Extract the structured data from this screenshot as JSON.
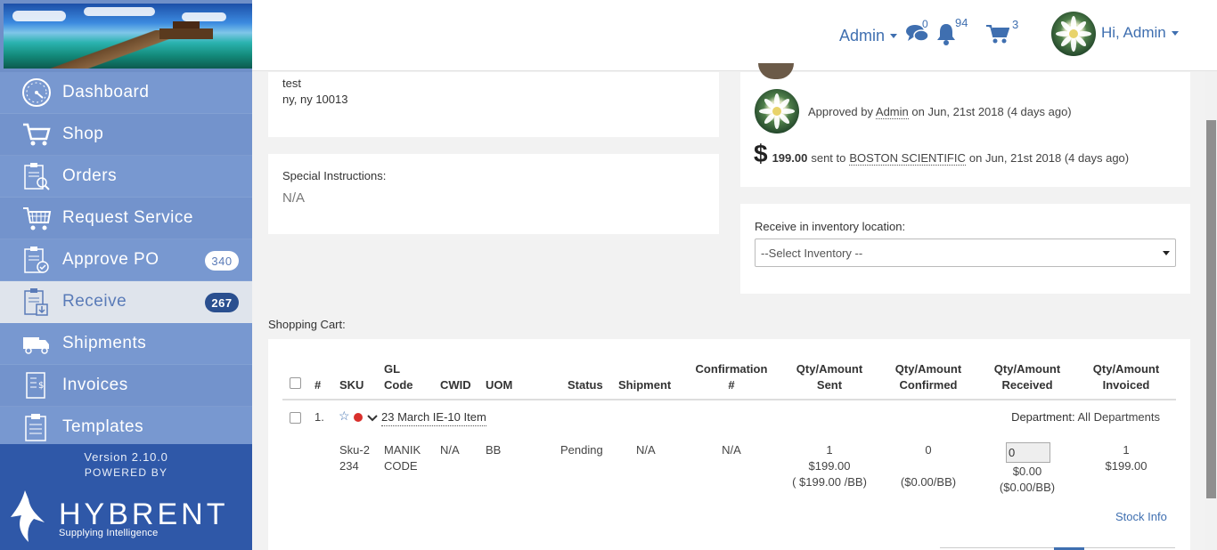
{
  "sidebar": {
    "items": [
      {
        "label": "Dashboard",
        "icon": "dashboard-icon"
      },
      {
        "label": "Shop",
        "icon": "cart-icon"
      },
      {
        "label": "Orders",
        "icon": "orders-icon"
      },
      {
        "label": "Request Service",
        "icon": "request-service-icon"
      },
      {
        "label": "Approve PO",
        "icon": "approve-po-icon",
        "badge": "340"
      },
      {
        "label": "Receive",
        "icon": "receive-icon",
        "badge": "267",
        "active": true
      },
      {
        "label": "Shipments",
        "icon": "truck-icon"
      },
      {
        "label": "Invoices",
        "icon": "invoices-icon"
      },
      {
        "label": "Templates",
        "icon": "templates-icon"
      }
    ],
    "version": "Version 2.10.0",
    "powered_by": "POWERED BY",
    "brand_name": "HYBRENT",
    "brand_tagline": "Supplying Intelligence"
  },
  "header": {
    "admin_label": "Admin",
    "messages_count": "0",
    "notifications_count": "94",
    "cart_count": "3",
    "greeting": "Hi, Admin"
  },
  "address": {
    "line1": "test",
    "line2": "ny, ny 10013"
  },
  "special_instructions": {
    "label": "Special Instructions:",
    "value": "N/A"
  },
  "activity": {
    "approved_prefix": "Approved by",
    "approved_user": "Admin",
    "approved_suffix": "on Jun, 21st 2018 (4 days ago)",
    "dollar_sign": "$",
    "sent_amount": "199.00",
    "sent_mid": "sent to",
    "sent_vendor": "BOSTON SCIENTIFIC",
    "sent_suffix": "on Jun, 21st 2018 (4 days ago)"
  },
  "inventory": {
    "label": "Receive in inventory location:",
    "selected": "--Select Inventory --"
  },
  "cart": {
    "title": "Shopping Cart:",
    "columns": {
      "num": "#",
      "sku": "SKU",
      "gl_code_1": "GL",
      "gl_code_2": "Code",
      "cwid": "CWID",
      "uom": "UOM",
      "status": "Status",
      "shipment": "Shipment",
      "confirmation_1": "Confirmation",
      "confirmation_2": "#",
      "sent_1": "Qty/Amount",
      "sent_2": "Sent",
      "confirmed_1": "Qty/Amount",
      "confirmed_2": "Confirmed",
      "received_1": "Qty/Amount",
      "received_2": "Received",
      "invoiced_1": "Qty/Amount",
      "invoiced_2": "Invoiced"
    },
    "row": {
      "index": "1.",
      "item_name": "23 March IE-10 Item",
      "department_label": "Department:",
      "department_value": "All Departments",
      "sku_1": "Sku-2",
      "sku_2": "234",
      "gl_1": "MANIK",
      "gl_2": "CODE",
      "cwid": "N/A",
      "uom": "BB",
      "status": "Pending",
      "shipment": "N/A",
      "confirmation": "N/A",
      "sent_qty": "1",
      "sent_amount": "$199.00",
      "sent_unit": "( $199.00 /BB)",
      "confirmed_qty": "0",
      "confirmed_unit": "($0.00/BB)",
      "received_qty": "0",
      "received_amount": "$0.00",
      "received_unit": "($0.00/BB)",
      "invoiced_qty": "1",
      "invoiced_amount": "$199.00",
      "stock_info": "Stock Info"
    }
  },
  "colors": {
    "sidebar": "#7393cc",
    "sidebar_footer": "#2f58a8",
    "accent": "#3f6fb0",
    "flag_red": "#d9302c"
  }
}
